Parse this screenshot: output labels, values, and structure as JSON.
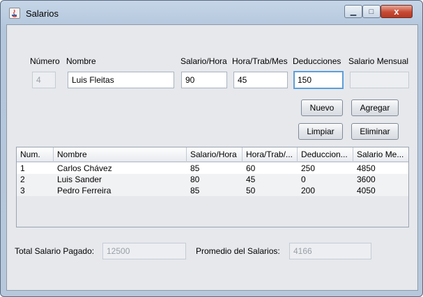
{
  "window": {
    "title": "Salarios",
    "min_glyph": "▁",
    "max_glyph": "□",
    "close_glyph": "x"
  },
  "form": {
    "labels": {
      "numero": "Número",
      "nombre": "Nombre",
      "salario_hora": "Salario/Hora",
      "hora_trab_mes": "Hora/Trab/Mes",
      "deducciones": "Deducciones",
      "salario_mensual": "Salario Mensual"
    },
    "values": {
      "numero": "4",
      "nombre": "Luis Fleitas",
      "salario_hora": "90",
      "hora_trab_mes": "45",
      "deducciones": "150",
      "salario_mensual": ""
    }
  },
  "buttons": {
    "nuevo": "Nuevo",
    "agregar": "Agregar",
    "limpiar": "Limpiar",
    "eliminar": "Eliminar"
  },
  "table": {
    "columns": [
      "Num.",
      "Nombre",
      "Salario/Hora",
      "Hora/Trab/...",
      "Deduccion...",
      "Salario Me..."
    ],
    "rows": [
      [
        "1",
        "Carlos Chávez",
        "85",
        "60",
        "250",
        "4850"
      ],
      [
        "2",
        "Luis Sander",
        "80",
        "45",
        "0",
        "3600"
      ],
      [
        "3",
        "Pedro Ferreira",
        "85",
        "50",
        "200",
        "4050"
      ]
    ]
  },
  "totals": {
    "total_label": "Total Salario Pagado:",
    "total_value": "12500",
    "promedio_label": "Promedio del Salarios:",
    "promedio_value": "4166"
  }
}
